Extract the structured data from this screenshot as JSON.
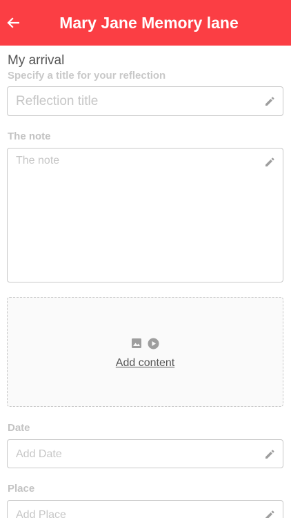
{
  "header": {
    "title": "Mary Jane Memory lane",
    "background_color": "#fb3e44",
    "back_icon": "arrow-left-icon"
  },
  "reflection": {
    "section_title": "My arrival",
    "subtitle": "Specify a title for your reflection",
    "title_placeholder": "Reflection title"
  },
  "note": {
    "label": "The note",
    "placeholder": "The note"
  },
  "media": {
    "add_label": "Add content",
    "icons": [
      "image-icon",
      "play-icon"
    ]
  },
  "date": {
    "label": "Date",
    "placeholder": "Add Date"
  },
  "place": {
    "label": "Place",
    "placeholder": "Add Place"
  }
}
